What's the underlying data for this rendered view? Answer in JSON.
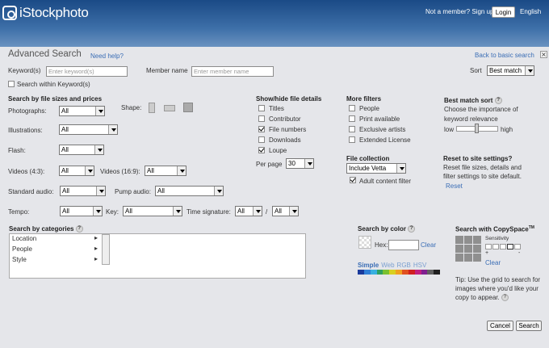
{
  "header": {
    "logo_text": "iStockphoto",
    "not_member": "Not a member? Sign up",
    "login_button": "Login",
    "language": "English"
  },
  "page": {
    "title": "Advanced Search",
    "need_help": "Need help?",
    "back_to_basic": "Back to basic search",
    "close_glyph": "×"
  },
  "keyword": {
    "label": "Keyword(s)",
    "placeholder": "Enter keyword(s)",
    "within_label": "Search within Keyword(s)"
  },
  "member": {
    "label": "Member name",
    "placeholder": "Enter member name"
  },
  "sort": {
    "label": "Sort",
    "value": "Best match"
  },
  "file_sizes": {
    "heading": "Search by file sizes and prices",
    "photographs_label": "Photographs:",
    "photographs_value": "All",
    "shape_label": "Shape:",
    "illustrations_label": "Illustrations:",
    "illustrations_value": "All",
    "flash_label": "Flash:",
    "flash_value": "All",
    "videos43_label": "Videos (4:3):",
    "videos43_value": "All",
    "videos169_label": "Videos (16:9):",
    "videos169_value": "All",
    "standard_audio_label": "Standard audio:",
    "standard_audio_value": "All",
    "pump_audio_label": "Pump audio:",
    "pump_audio_value": "All",
    "tempo_label": "Tempo:",
    "tempo_value": "All",
    "key_label": "Key:",
    "key_value": "All",
    "time_sig_label": "Time signature:",
    "time_sig_value_1": "All",
    "time_sig_sep": "/",
    "time_sig_value_2": "All"
  },
  "show_hide": {
    "heading": "Show/hide file details",
    "items": [
      {
        "label": "Titles",
        "checked": false
      },
      {
        "label": "Contributor",
        "checked": false
      },
      {
        "label": "File numbers",
        "checked": true
      },
      {
        "label": "Downloads",
        "checked": false
      },
      {
        "label": "Loupe",
        "checked": true
      }
    ],
    "per_page_label": "Per page",
    "per_page_value": "30"
  },
  "more_filters": {
    "heading": "More filters",
    "items": [
      {
        "label": "People",
        "checked": false
      },
      {
        "label": "Print available",
        "checked": false
      },
      {
        "label": "Exclusive artists",
        "checked": false
      },
      {
        "label": "Extended License",
        "checked": false
      }
    ]
  },
  "file_collection": {
    "heading": "File collection",
    "value": "Include Vetta",
    "adult_label": "Adult content filter",
    "adult_checked": true
  },
  "best_match": {
    "heading": "Best match sort",
    "desc_1": "Choose the importance of",
    "desc_2": "keyword relevance",
    "low": "low",
    "high": "high",
    "slider_level": 0.5
  },
  "reset": {
    "heading": "Reset to site settings?",
    "desc_1": "Reset file sizes, details and",
    "desc_2": "filter settings to site default.",
    "link": "Reset"
  },
  "categories": {
    "heading": "Search by categories",
    "items": [
      "Location",
      "People",
      "Style"
    ]
  },
  "color": {
    "heading": "Search by color",
    "hex_label": "Hex:",
    "clear": "Clear",
    "modes": [
      "Simple",
      "Web",
      "RGB",
      "HSV"
    ],
    "swatches": [
      "#1a3a9c",
      "#2f7fd6",
      "#38b0e0",
      "#30a060",
      "#7ac030",
      "#d8d020",
      "#f0a020",
      "#e05020",
      "#d02020",
      "#c02080",
      "#802090",
      "#606060",
      "#202020"
    ]
  },
  "copyspace": {
    "heading": "Search with CopySpace",
    "tm": "TM",
    "sensitivity": "Sensitivity",
    "plus": "+",
    "minus": "-",
    "clear": "Clear",
    "tip_1": "Tip: Use the grid to search for",
    "tip_2": "images where you'd like your",
    "tip_3": "copy to appear."
  },
  "actions": {
    "cancel": "Cancel",
    "search": "Search"
  },
  "icons": {
    "help": "?",
    "arrow_right": "▸"
  }
}
